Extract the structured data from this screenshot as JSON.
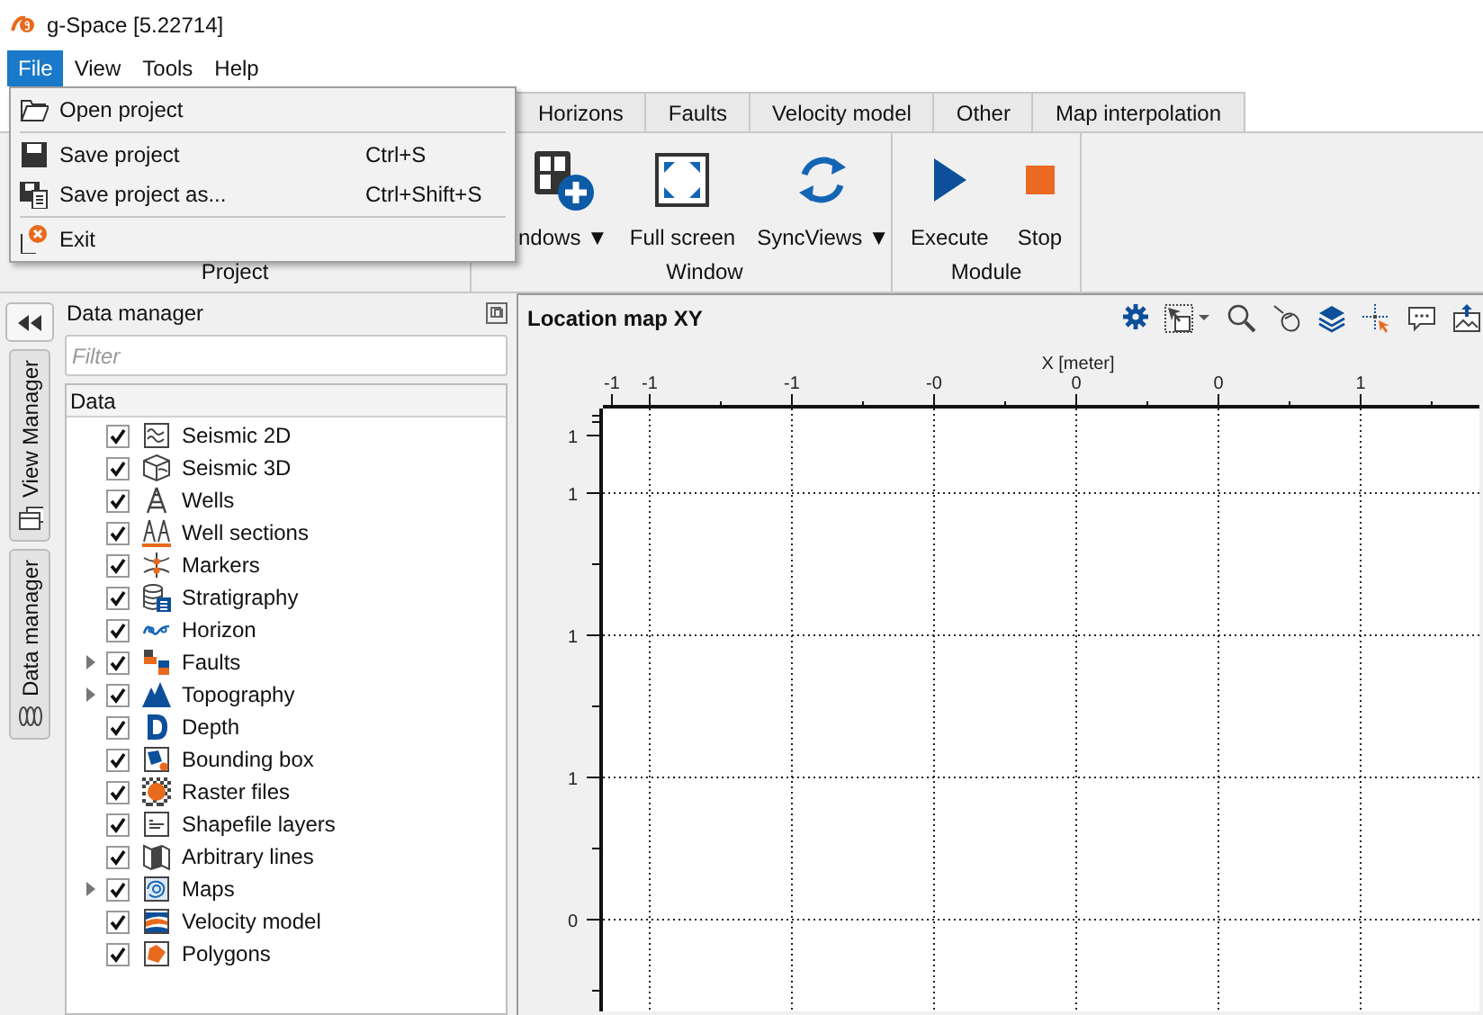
{
  "window": {
    "title": "g-Space [5.22714]"
  },
  "menu_bar": [
    {
      "label": "File",
      "selected": true
    },
    {
      "label": "View",
      "selected": false
    },
    {
      "label": "Tools",
      "selected": false
    },
    {
      "label": "Help",
      "selected": false
    }
  ],
  "file_menu": [
    {
      "kind": "item",
      "label": "Open project"
    },
    {
      "kind": "separator"
    },
    {
      "kind": "item",
      "label": "Save project",
      "shortcut": "Ctrl+S"
    },
    {
      "kind": "item",
      "label": "Save project as...",
      "shortcut": "Ctrl+Shift+S"
    },
    {
      "kind": "separator"
    },
    {
      "kind": "item",
      "label": "Exit"
    }
  ],
  "ribbon_tabs": [
    {
      "label": "Horizons",
      "selected": false
    },
    {
      "label": "Faults",
      "selected": false
    },
    {
      "label": "Velocity model",
      "selected": false
    },
    {
      "label": "Other",
      "selected": false
    },
    {
      "label": "Map interpolation",
      "selected": false
    }
  ],
  "ribbon_groups": [
    {
      "label": "Project"
    },
    {
      "label": "Window",
      "buttons": [
        {
          "label": "ndows ▼"
        },
        {
          "label": "Full screen"
        },
        {
          "label": "SyncViews ▼"
        }
      ]
    },
    {
      "label": "Module",
      "buttons": [
        {
          "label": "Execute"
        },
        {
          "label": "Stop"
        }
      ]
    }
  ],
  "side_tabs": [
    {
      "label": "View Manager"
    },
    {
      "label": "Data manager"
    }
  ],
  "data_manager": {
    "title": "Data manager",
    "filter": {
      "placeholder": "Filter"
    },
    "column": "Data",
    "items": [
      {
        "label": "Seismic 2D",
        "checked": true,
        "expandable": false
      },
      {
        "label": "Seismic 3D",
        "checked": true,
        "expandable": false
      },
      {
        "label": "Wells",
        "checked": true,
        "expandable": false
      },
      {
        "label": "Well sections",
        "checked": true,
        "expandable": false
      },
      {
        "label": "Markers",
        "checked": true,
        "expandable": false
      },
      {
        "label": "Stratigraphy",
        "checked": true,
        "expandable": false
      },
      {
        "label": "Horizon",
        "checked": true,
        "expandable": false
      },
      {
        "label": "Faults",
        "checked": true,
        "expandable": true
      },
      {
        "label": "Topography",
        "checked": true,
        "expandable": true
      },
      {
        "label": "Depth",
        "checked": true,
        "expandable": false
      },
      {
        "label": "Bounding box",
        "checked": true,
        "expandable": false
      },
      {
        "label": "Raster files",
        "checked": true,
        "expandable": false
      },
      {
        "label": "Shapefile layers",
        "checked": true,
        "expandable": false
      },
      {
        "label": "Arbitrary lines",
        "checked": true,
        "expandable": false
      },
      {
        "label": "Maps",
        "checked": true,
        "expandable": true
      },
      {
        "label": "Velocity model",
        "checked": true,
        "expandable": false
      },
      {
        "label": "Polygons",
        "checked": true,
        "expandable": false
      }
    ]
  },
  "map_view": {
    "title": "Location map XY",
    "x_axis": {
      "label": "X [meter]",
      "ticks": [
        "-1",
        "-1",
        "-1",
        "-0",
        "0",
        "0",
        "1"
      ]
    },
    "y_axis": {
      "ticks": [
        "1",
        "1",
        "1",
        "1",
        "0"
      ]
    }
  }
}
